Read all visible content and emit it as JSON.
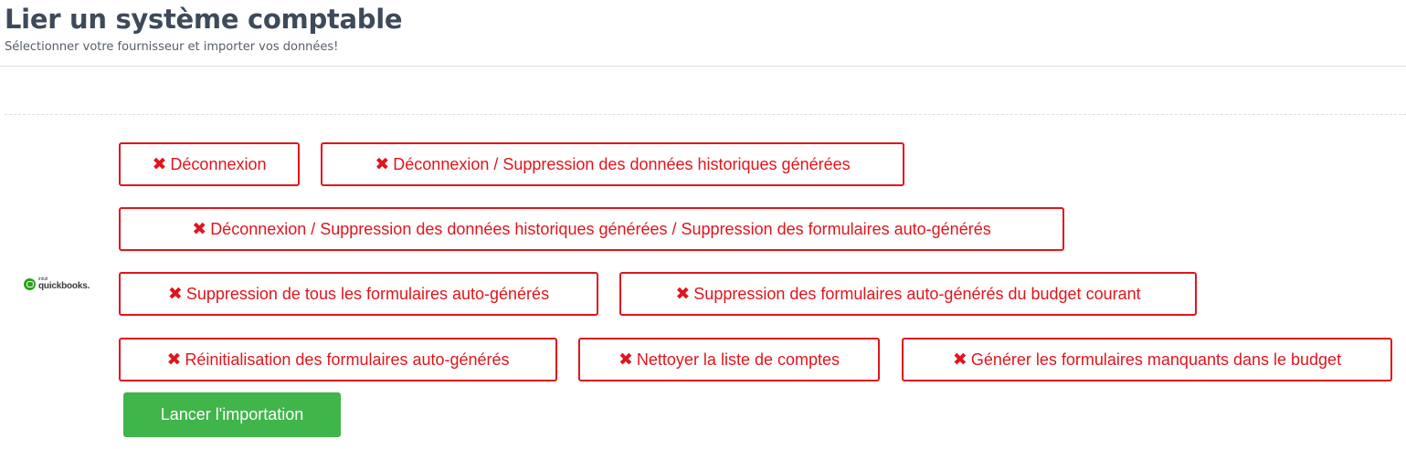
{
  "header": {
    "title": "Lier un système comptable",
    "subtitle": "Sélectionner votre fournisseur et importer vos données!"
  },
  "provider": {
    "logo_small": "intuit",
    "logo_main": "quickbooks.",
    "brand_color": "#2ca01c"
  },
  "actions": {
    "icon_glyph": "✖",
    "icon_name": "times-icon",
    "danger_color": "#e0151d",
    "disconnect": "Déconnexion",
    "disconnect_delete_history": "Déconnexion / Suppression des données historiques générées",
    "disconnect_delete_all": "Déconnexion / Suppression des données historiques générées / Suppression des formulaires auto-générés",
    "delete_all_forms": "Suppression de tous les formulaires auto-générés",
    "delete_current_budget_forms": "Suppression des formulaires auto-générés du budget courant",
    "reset_forms": "Réinitialisation des formulaires auto-générés",
    "clean_accounts": "Nettoyer la liste de comptes",
    "generate_missing_forms": "Générer les formulaires manquants dans le budget"
  },
  "import_button": {
    "label": "Lancer l'importation",
    "color": "#3fb54a"
  }
}
